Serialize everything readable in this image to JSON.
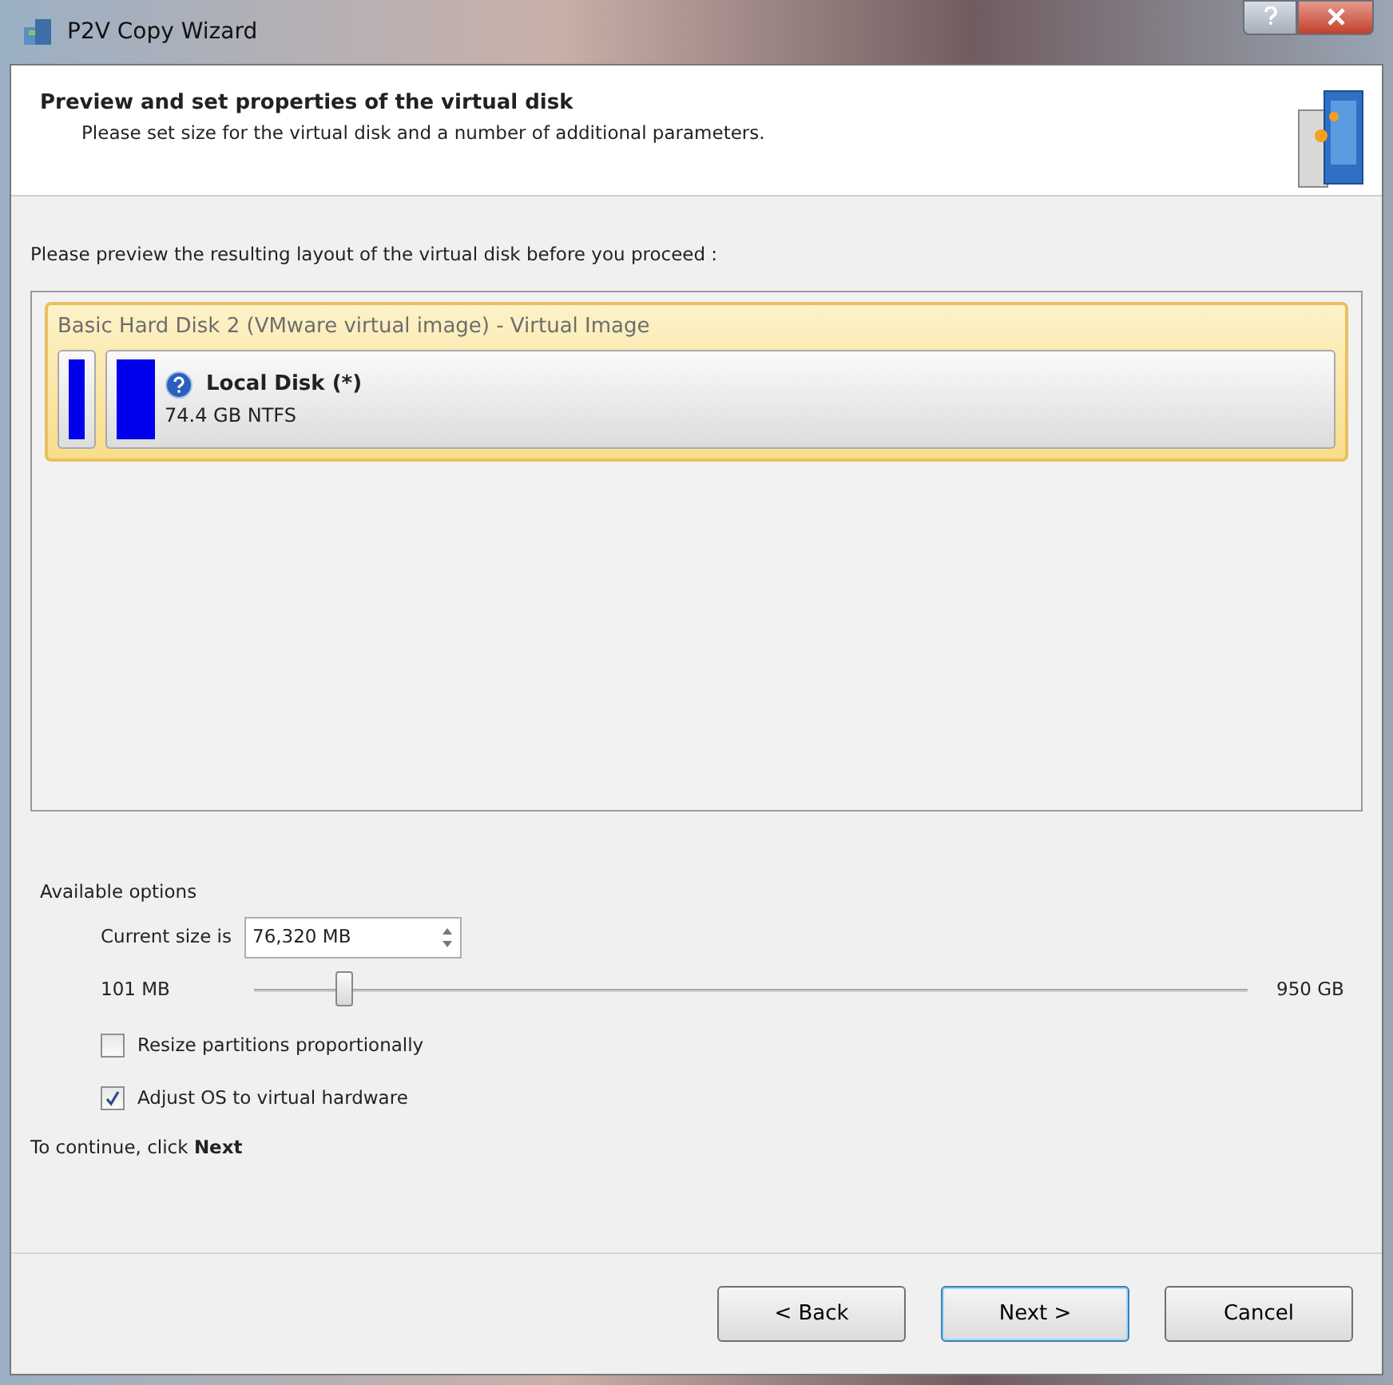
{
  "window": {
    "title": "P2V Copy Wizard"
  },
  "header": {
    "title": "Preview and set properties of the virtual disk",
    "subtitle": "Please set size for the virtual disk and a number of additional parameters."
  },
  "preview": {
    "instruction": "Please preview the resulting layout of the virtual disk before you proceed :",
    "disk": {
      "title": "Basic Hard Disk 2 (VMware virtual image) - Virtual Image",
      "selected": true,
      "partitions": [
        {
          "kind": "unlabeled"
        },
        {
          "kind": "labeled",
          "name": "Local Disk (*)",
          "detail": "74.4 GB NTFS"
        }
      ]
    }
  },
  "options": {
    "heading": "Available options",
    "size_label": "Current size is",
    "size_value": "76,320 MB",
    "slider": {
      "min_label": "101 MB",
      "max_label": "950 GB",
      "level": 0.09
    },
    "checkboxes": [
      {
        "label": "Resize partitions proportionally",
        "checked": false
      },
      {
        "label": "Adjust OS to virtual hardware",
        "checked": true
      }
    ]
  },
  "footer_text": "To continue, click **Next**",
  "buttons": [
    {
      "label": "< Back",
      "focused": false
    },
    {
      "label": "Next >",
      "focused": true
    },
    {
      "label": "Cancel",
      "focused": false
    }
  ]
}
